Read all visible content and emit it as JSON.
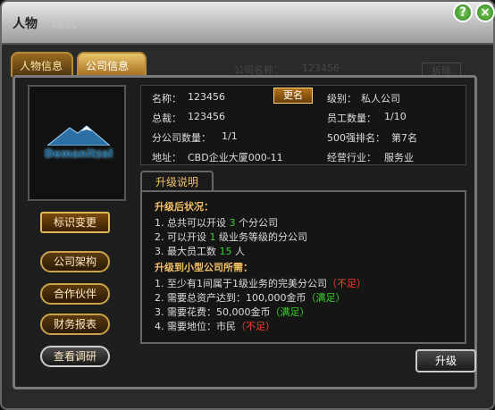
{
  "window": {
    "title": "人物",
    "ghost_title": "成就"
  },
  "tabs": [
    {
      "label": "人物信息"
    },
    {
      "label": "公司信息"
    }
  ],
  "background_ghost": {
    "company_name_label": "公司名称：",
    "company_name_value": "123456",
    "fire_button": "拆除",
    "number": "3456"
  },
  "logo": {
    "text": "Demanitzal"
  },
  "side_buttons": [
    {
      "label": "标识变更"
    },
    {
      "label": "公司架构"
    },
    {
      "label": "合作伙伴"
    },
    {
      "label": "财务报表"
    },
    {
      "label": "查看调研"
    }
  ],
  "info": {
    "name_label": "名称：",
    "name_value": "123456",
    "rename_button": "更名",
    "level_label": "级别：",
    "level_value": "私人公司",
    "ceo_label": "总裁：",
    "ceo_value": "123456",
    "staff_label": "员工数量：",
    "staff_value": "1/10",
    "branch_label": "分公司数量：",
    "branch_value": "1/1",
    "rank_label": "500强排名：",
    "rank_value": "第7名",
    "address_label": "地址：",
    "address_value": "CBD企业大厦000-11",
    "industry_label": "经营行业：",
    "industry_value": "服务业"
  },
  "upgrade": {
    "tab_label": "升级说明",
    "after_header": "升级后状况：",
    "after": [
      {
        "pre": "1. 总共可以开设 ",
        "num": "3",
        "post": " 个分公司"
      },
      {
        "pre": "2. 可以开设 ",
        "num": "1",
        "post": " 级业务等级的分公司"
      },
      {
        "pre": "3. 最大员工数 ",
        "num": "15",
        "post": " 人"
      }
    ],
    "need_header": "升级到小型公司所需：",
    "needs": [
      {
        "text": "1. 至少有1间属于1级业务的完美分公司",
        "status": "（不足）",
        "ok": false
      },
      {
        "text": "2. 需要总资产达到：100,000金币",
        "status": "（满足）",
        "ok": true
      },
      {
        "text": "3. 需要花费：50,000金币",
        "status": "（满足）",
        "ok": true
      },
      {
        "text": "4. 需要地位：市民",
        "status": "（不足）",
        "ok": false
      }
    ],
    "button": "升级"
  },
  "colors": {
    "gold": "#f4c067",
    "green": "#39d12b",
    "red": "#ff3b2b"
  }
}
